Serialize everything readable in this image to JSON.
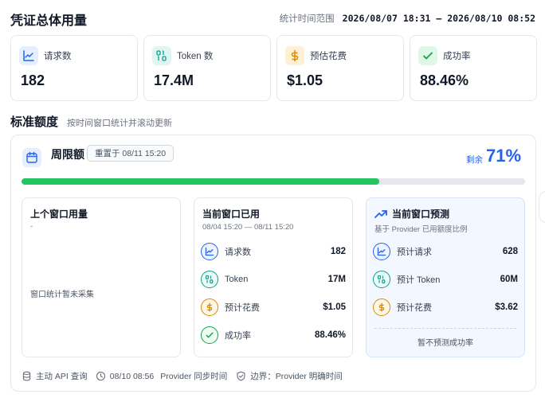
{
  "header": {
    "title": "凭证总体用量",
    "range_label": "统计时间范围",
    "range_value": "2026/08/07 18:31 — 2026/08/10 08:52"
  },
  "stats": [
    {
      "label": "请求数",
      "value": "182",
      "icon": "chart-line-icon"
    },
    {
      "label": "Token 数",
      "value": "17.4M",
      "icon": "binary-icon"
    },
    {
      "label": "预估花费",
      "value": "$1.05",
      "icon": "dollar-icon"
    },
    {
      "label": "成功率",
      "value": "88.46%",
      "icon": "check-icon"
    }
  ],
  "section": {
    "title": "标准额度",
    "subtitle": "按时间窗口统计并滚动更新"
  },
  "quota": {
    "name": "周限额",
    "reset": "重置于 08/11 15:20",
    "remaining_label": "剩余",
    "remaining_value": "71%",
    "progress_fraction": 0.71,
    "colors": {
      "accent": "#2563eb",
      "progress": "#22c55e"
    }
  },
  "previous_window": {
    "title": "上个窗口用量",
    "desc": "-",
    "empty_note": "窗口统计暂未采集"
  },
  "current_window": {
    "title": "当前窗口已用",
    "range": "08/04 15:20 — 08/11 15:20",
    "metrics": [
      {
        "label": "请求数",
        "value": "182",
        "icon": "chart-line-icon"
      },
      {
        "label": "Token",
        "value": "17M",
        "icon": "binary-icon"
      },
      {
        "label": "预计花费",
        "value": "$1.05",
        "icon": "dollar-icon"
      },
      {
        "label": "成功率",
        "value": "88.46%",
        "icon": "check-icon"
      }
    ]
  },
  "forecast": {
    "title": "当前窗口预测",
    "desc": "基于 Provider 已用额度比例",
    "metrics": [
      {
        "label": "预计请求",
        "value": "628",
        "icon": "chart-line-icon"
      },
      {
        "label": "预计 Token",
        "value": "60M",
        "icon": "binary-icon"
      },
      {
        "label": "预计花费",
        "value": "$3.62",
        "icon": "dollar-icon"
      }
    ],
    "note": "暂不预测成功率"
  },
  "footer": {
    "source": "主动 API 查询",
    "time": "08/10 08:56",
    "sync": "Provider 同步时间",
    "boundary": "边界：Provider 明确时间"
  }
}
